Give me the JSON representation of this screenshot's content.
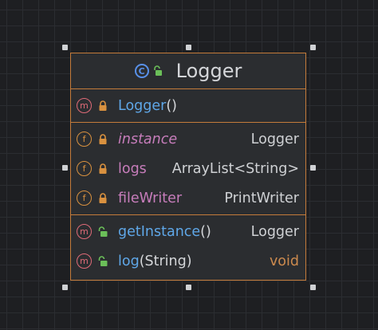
{
  "diagram": {
    "class_name": "Logger",
    "class_icon": "c-icon",
    "colors": {
      "background": "#1e1f22",
      "border": "#c47b3a",
      "method_name": "#5fa7e8",
      "field_name": "#c77dbb",
      "method_badge": "#e06b78",
      "field_badge": "#d9913f"
    },
    "constructors": [
      {
        "badge": "m",
        "access": "private",
        "name": "Logger",
        "params": "()",
        "type": ""
      }
    ],
    "fields": [
      {
        "badge": "f",
        "access": "private",
        "name": "instance",
        "static": true,
        "type": "Logger"
      },
      {
        "badge": "f",
        "access": "private",
        "name": "logs",
        "static": false,
        "type": "ArrayList<String>"
      },
      {
        "badge": "f",
        "access": "private",
        "name": "fileWriter",
        "static": false,
        "type": "PrintWriter"
      }
    ],
    "methods": [
      {
        "badge": "m",
        "access": "public",
        "name": "getInstance",
        "params": "()",
        "type": "Logger"
      },
      {
        "badge": "m",
        "access": "public",
        "name": "log",
        "params": "(String)",
        "type": "void"
      }
    ]
  }
}
